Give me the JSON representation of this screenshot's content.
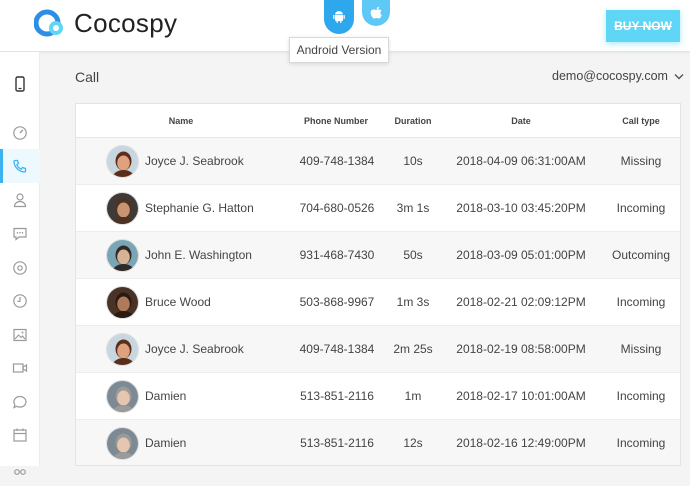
{
  "header": {
    "brand": "Cocospy",
    "tooltip": "Android Version",
    "buy_label": "BUY NOW"
  },
  "page": {
    "title": "Call",
    "account": "demo@cocospy.com"
  },
  "sidebar": {
    "items": [
      {
        "icon": "phone-device-icon"
      },
      {
        "icon": "dashboard-icon"
      },
      {
        "icon": "calls-icon",
        "active": true
      },
      {
        "icon": "contacts-icon"
      },
      {
        "icon": "messages-icon"
      },
      {
        "icon": "location-icon"
      },
      {
        "icon": "history-icon"
      },
      {
        "icon": "photos-icon"
      },
      {
        "icon": "video-icon"
      },
      {
        "icon": "chat-icon"
      },
      {
        "icon": "calendar-icon"
      }
    ]
  },
  "table": {
    "columns": [
      "Name",
      "Phone Number",
      "Duration",
      "Date",
      "Call type"
    ],
    "rows": [
      {
        "name": "Joyce J. Seabrook",
        "phone": "409-748-1384",
        "duration": "10s",
        "date": "2018-04-09 06:31:00AM",
        "type": "Missing",
        "avatar": {
          "skin": "#e0a27e",
          "hair": "#5a2e1a",
          "bg": "#c8d6e0"
        }
      },
      {
        "name": "Stephanie G. Hatton",
        "phone": "704-680-0526",
        "duration": "3m 1s",
        "date": "2018-03-10 03:45:20PM",
        "type": "Incoming",
        "avatar": {
          "skin": "#c99473",
          "hair": "#4b3222",
          "bg": "#3f3a36"
        }
      },
      {
        "name": "John E. Washington",
        "phone": "931-468-7430",
        "duration": "50s",
        "date": "2018-03-09 05:01:00PM",
        "type": "Outcoming",
        "avatar": {
          "skin": "#d8b295",
          "hair": "#2f2a28",
          "bg": "#7aa5b5"
        }
      },
      {
        "name": "Bruce Wood",
        "phone": "503-868-9967",
        "duration": "1m 3s",
        "date": "2018-02-21 02:09:12PM",
        "type": "Incoming",
        "avatar": {
          "skin": "#b07a5a",
          "hair": "#2a1a12",
          "bg": "#4a3326"
        }
      },
      {
        "name": "Joyce J. Seabrook",
        "phone": "409-748-1384",
        "duration": "2m 25s",
        "date": "2018-02-19 08:58:00PM",
        "type": "Missing",
        "avatar": {
          "skin": "#e0a27e",
          "hair": "#5a2e1a",
          "bg": "#c8d6e0"
        }
      },
      {
        "name": "Damien",
        "phone": "513-851-2116",
        "duration": "1m",
        "date": "2018-02-17 10:01:00AM",
        "type": "Incoming",
        "avatar": {
          "skin": "#e6c6b0",
          "hair": "#9a9a9a",
          "bg": "#7d8a94"
        }
      },
      {
        "name": "Damien",
        "phone": "513-851-2116",
        "duration": "12s",
        "date": "2018-02-16 12:49:00PM",
        "type": "Incoming",
        "avatar": {
          "skin": "#e6c6b0",
          "hair": "#9a9a9a",
          "bg": "#7d8a94"
        }
      }
    ]
  },
  "colors": {
    "accent": "#3cb4f0",
    "buy_button": "#5fd6f6",
    "logo_blue": "#2c8ee6",
    "logo_light": "#5fd6f6"
  }
}
